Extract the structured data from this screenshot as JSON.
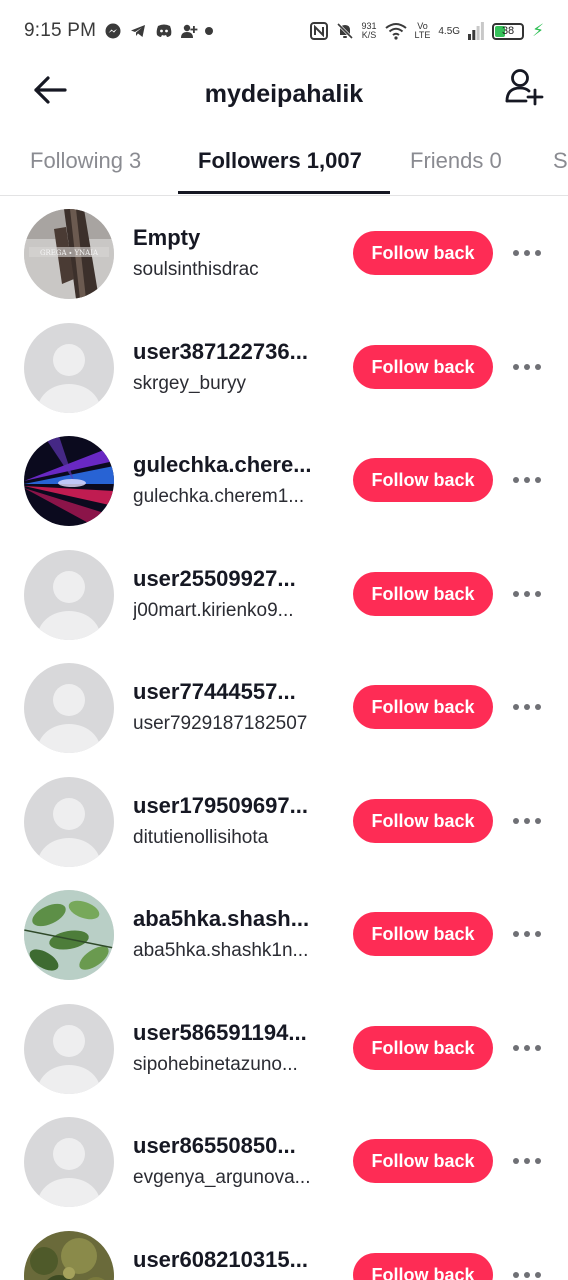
{
  "status_bar": {
    "time": "9:15 PM",
    "net_speed_value": "931",
    "net_speed_unit": "K/S",
    "volte_top": "Vo",
    "volte_bottom": "LTE",
    "network": "4.5G",
    "battery": "38",
    "icons": [
      "messenger-icon",
      "telegram-icon",
      "discord-icon",
      "add-contact-icon",
      "dot-icon",
      "nfc-icon",
      "mute-bell-icon",
      "wifi-icon",
      "signal-icon",
      "battery-icon",
      "charging-icon"
    ]
  },
  "header": {
    "title": "mydeipahalik",
    "back_icon": "back-arrow-icon",
    "add_icon": "add-user-icon"
  },
  "tabs": [
    {
      "label": "Following 3",
      "active": false
    },
    {
      "label": "Followers 1,007",
      "active": true
    },
    {
      "label": "Friends 0",
      "active": false
    },
    {
      "label": "S",
      "active": false
    }
  ],
  "follow_label": "Follow back",
  "followers": [
    {
      "name": "Empty",
      "handle": "soulsinthisdrac",
      "avatar": "photo-dark-fabric"
    },
    {
      "name": "user387122736...",
      "handle": "skrgey_buryy",
      "avatar": "default"
    },
    {
      "name": "gulechka.chere...",
      "handle": "gulechka.cherem1...",
      "avatar": "photo-neon-lights"
    },
    {
      "name": "user25509927...",
      "handle": "j00mart.kirienko9...",
      "avatar": "default"
    },
    {
      "name": "user77444557...",
      "handle": "user7929187182507",
      "avatar": "default"
    },
    {
      "name": "user179509697...",
      "handle": "ditutienollisihota",
      "avatar": "default"
    },
    {
      "name": "aba5hka.shash...",
      "handle": "aba5hka.shashk1n...",
      "avatar": "photo-green-leaves"
    },
    {
      "name": "user586591194...",
      "handle": "sipohebinetazuno...",
      "avatar": "default"
    },
    {
      "name": "user86550850...",
      "handle": "evgenya_argunova...",
      "avatar": "default"
    },
    {
      "name": "user608210315...",
      "handle": "",
      "avatar": "photo-forest"
    }
  ],
  "colors": {
    "accent": "#fe2c55",
    "text": "#161823",
    "muted_tab": "#8a8b91"
  }
}
